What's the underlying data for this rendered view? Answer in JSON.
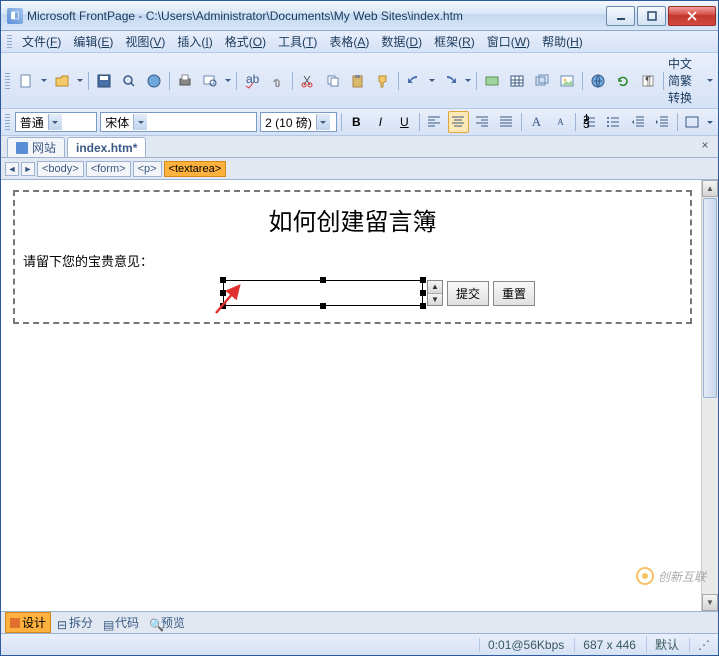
{
  "window": {
    "title": "Microsoft FrontPage - C:\\Users\\Administrator\\Documents\\My Web Sites\\index.htm"
  },
  "menu": {
    "items": [
      {
        "l": "文件",
        "k": "F"
      },
      {
        "l": "编辑",
        "k": "E"
      },
      {
        "l": "视图",
        "k": "V"
      },
      {
        "l": "插入",
        "k": "I"
      },
      {
        "l": "格式",
        "k": "O"
      },
      {
        "l": "工具",
        "k": "T"
      },
      {
        "l": "表格",
        "k": "A"
      },
      {
        "l": "数据",
        "k": "D"
      },
      {
        "l": "框架",
        "k": "R"
      },
      {
        "l": "窗口",
        "k": "W"
      },
      {
        "l": "帮助",
        "k": "H"
      }
    ]
  },
  "toolbar2_label": "中文简繁转换",
  "format": {
    "style": "普通",
    "font": "宋体",
    "size": "2 (10 磅)"
  },
  "tabs": {
    "site": "网站",
    "file": "index.htm*"
  },
  "breadcrumb": [
    "<body>",
    "<form>",
    "<p>",
    "<textarea>"
  ],
  "content": {
    "heading": "如何创建留言簿",
    "label": "请留下您的宝贵意见：",
    "submit": "提交",
    "reset": "重置"
  },
  "views": {
    "design": "设计",
    "split": "拆分",
    "code": "代码",
    "preview": "预览"
  },
  "status": {
    "speed": "0:01@56Kbps",
    "size": "687 x 446",
    "mode": "默认"
  },
  "watermark": "创新互联"
}
